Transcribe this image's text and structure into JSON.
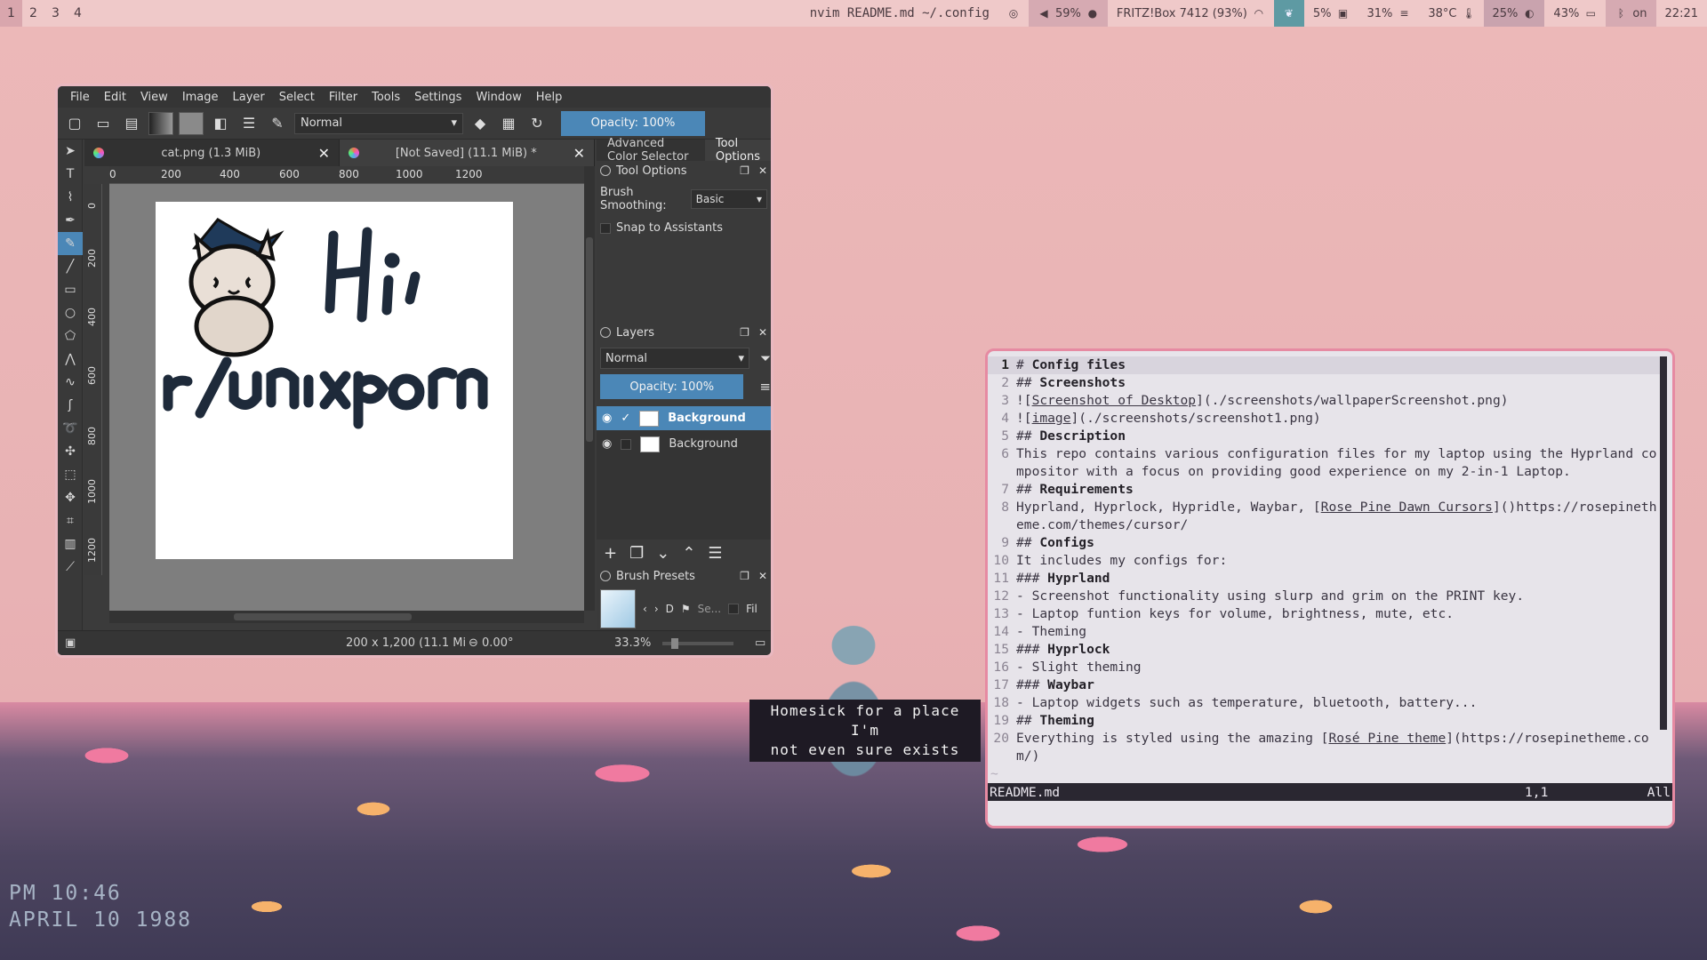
{
  "topbar": {
    "workspaces": [
      "1",
      "2",
      "3",
      "4"
    ],
    "window_title": "nvim README.md ~/.config",
    "volume": "59%",
    "wifi": "FRITZ!Box 7412 (93%)",
    "cpu": "5%",
    "memory": "31%",
    "temperature": "38°C",
    "brightness": "25%",
    "battery": "43%",
    "bluetooth": "on",
    "clock": "22:21"
  },
  "krita": {
    "menu": [
      "File",
      "Edit",
      "View",
      "Image",
      "Layer",
      "Select",
      "Filter",
      "Tools",
      "Settings",
      "Window",
      "Help"
    ],
    "blend_mode": "Normal",
    "opacity": "Opacity: 100%",
    "tabs": [
      {
        "label": "cat.png (1.3 MiB)"
      },
      {
        "label": "[Not Saved]  (11.1 MiB) *"
      }
    ],
    "ruler_h": [
      "0",
      "200",
      "400",
      "600",
      "800",
      "1000",
      "1200"
    ],
    "ruler_v": [
      "0",
      "200",
      "400",
      "600",
      "800",
      "1000",
      "1200"
    ],
    "canvas_text": "Hi, r/unixporn",
    "status": {
      "dimensions": "200 x 1,200 (11.1 Mi",
      "rotation": "0.00°",
      "zoom": "33.3%"
    },
    "docker_tabs": [
      "Advanced Color Selector",
      "Tool Options"
    ],
    "tool_options": {
      "title": "Tool Options",
      "smoothing_label": "Brush Smoothing:",
      "smoothing_value": "Basic",
      "snap_label": "Snap to Assistants"
    },
    "layers": {
      "title": "Layers",
      "blend": "Normal",
      "opacity": "Opacity:  100%",
      "items": [
        {
          "name": "Background"
        },
        {
          "name": "Background"
        }
      ]
    },
    "brush_presets": {
      "title": "Brush Presets",
      "tag": "D",
      "search_placeholder": "Se...",
      "filter_label": "Fil"
    }
  },
  "editor": {
    "lines": [
      {
        "n": "1",
        "text": "# Config files",
        "heading": true
      },
      {
        "n": "2",
        "text": "## Screenshots",
        "heading": true
      },
      {
        "n": "3",
        "pre": "![",
        "link": "Screenshot of Desktop",
        "post": "](./screenshots/wallpaperScreenshot.png)"
      },
      {
        "n": "4",
        "pre": "![",
        "link": "image",
        "post": "](./screenshots/screenshot1.png)"
      },
      {
        "n": "5",
        "text": "## Description",
        "heading": true
      },
      {
        "n": "6",
        "text": "This repo contains various configuration files for my laptop using the Hyprland compositor with a focus on providing good experience on my 2-in-1 Laptop."
      },
      {
        "n": "7",
        "text": "## Requirements",
        "heading": true
      },
      {
        "n": "8",
        "pre": "Hyprland, Hyprlock, Hypridle, Waybar, [",
        "link": "Rose Pine Dawn Cursors",
        "post": "]()https://rosepinetheme.com/themes/cursor/"
      },
      {
        "n": "9",
        "text": "## Configs",
        "heading": true
      },
      {
        "n": "10",
        "text": "It includes my configs for:"
      },
      {
        "n": "11",
        "text": "### Hyprland",
        "heading": true
      },
      {
        "n": "12",
        "text": "- Screenshot functionality using slurp and grim on the PRINT key."
      },
      {
        "n": "13",
        "text": "- Laptop funtion keys for volume, brightness, mute, etc."
      },
      {
        "n": "14",
        "text": "- Theming"
      },
      {
        "n": "15",
        "text": "### Hyprlock",
        "heading": true
      },
      {
        "n": "16",
        "text": "- Slight theming"
      },
      {
        "n": "17",
        "text": "### Waybar",
        "heading": true
      },
      {
        "n": "18",
        "text": "- Laptop widgets such as temperature, bluetooth, battery..."
      },
      {
        "n": "19",
        "text": "## Theming",
        "heading": true
      },
      {
        "n": "20",
        "pre": "Everything is styled using the amazing [",
        "link": "Rosé Pine theme",
        "post": "](https://rosepinetheme.com/)"
      }
    ],
    "tilde": "~",
    "status_file": "README.md",
    "status_pos": "1,1",
    "status_all": "All"
  },
  "wallpaper": {
    "caption_line1": "Homesick for a place I'm",
    "caption_line2": "not even sure exists",
    "vhs_time": "PM 10:46",
    "vhs_date": "APRIL 10 1988"
  }
}
